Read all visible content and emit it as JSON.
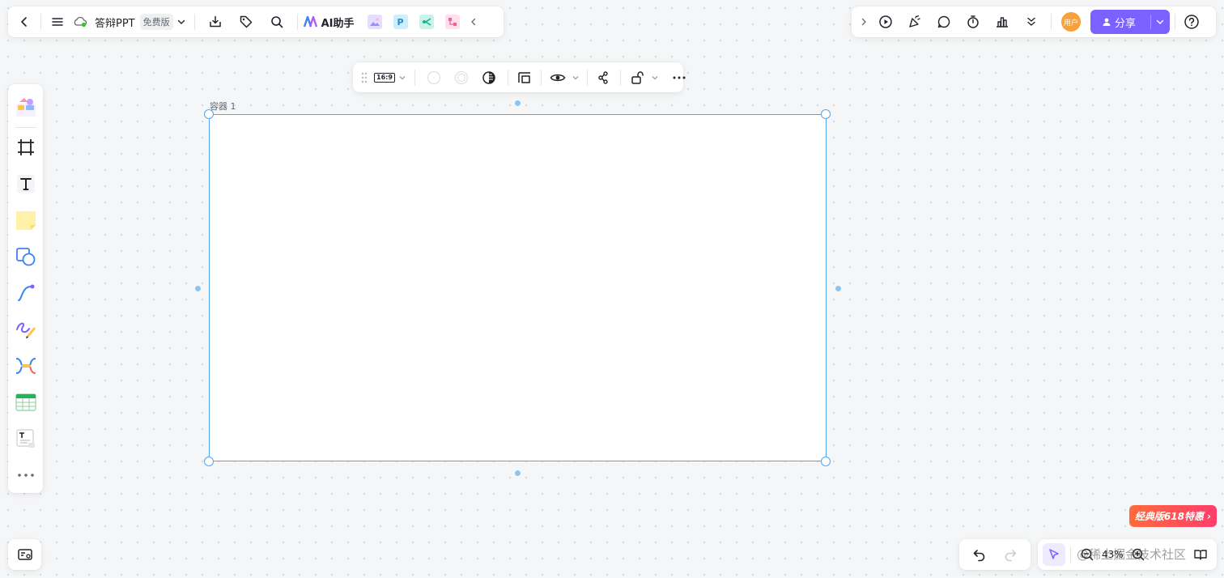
{
  "header": {
    "doc_title": "答辩PPT",
    "edition_badge": "免费版",
    "ai_assistant_label": "AI助手",
    "app_chip_p": "P"
  },
  "share": {
    "label": "分享",
    "avatar_text": "用户"
  },
  "container_toolbar": {
    "aspect_ratio": "16:9"
  },
  "canvas": {
    "container_label": "容器 1"
  },
  "promo": {
    "label": "经典版618特惠 ›"
  },
  "zoom": {
    "level": "43%"
  },
  "watermark": "@稀土掘金技术社区",
  "colors": {
    "accent": "#7b61ff",
    "selection": "#4ea7f0",
    "avatar": "#f7a13b",
    "promo_start": "#ff6a3d",
    "promo_end": "#ff3e6c"
  },
  "left_tools": [
    "materials-icon",
    "frame-icon",
    "text-icon",
    "sticky-note-icon",
    "shape-icon",
    "connector-icon",
    "pen-icon",
    "mindmap-icon",
    "table-icon",
    "text-card-icon",
    "more-icon"
  ]
}
